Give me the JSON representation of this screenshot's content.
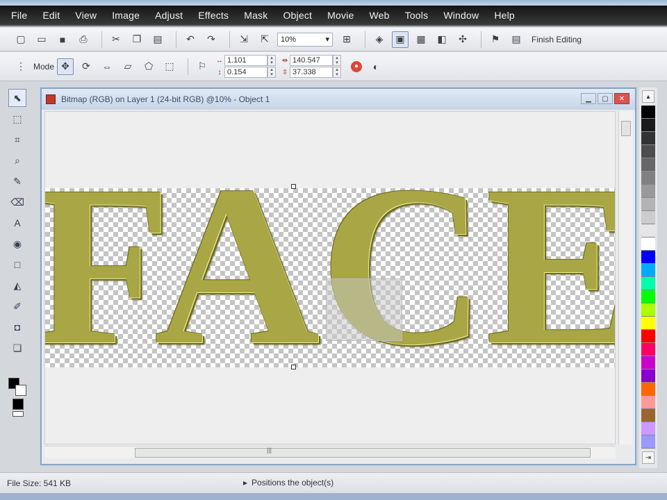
{
  "menu": [
    "File",
    "Edit",
    "View",
    "Image",
    "Adjust",
    "Effects",
    "Mask",
    "Object",
    "Movie",
    "Web",
    "Tools",
    "Window",
    "Help"
  ],
  "toolbar1": {
    "zoom_value": "10%",
    "finish_label": "Finish Editing"
  },
  "toolbar2": {
    "mode_label": "Mode",
    "x_value": "1.101",
    "y_value": "0.154",
    "width_value": "140.547",
    "height_value": "37.338"
  },
  "document": {
    "title": "Bitmap (RGB) on Layer 1 (24-bit RGB) @10% - Object 1",
    "canvas_text": "FACE"
  },
  "status": {
    "file_size": "File Size: 541 KB",
    "message": "Positions the object(s)"
  },
  "palette_colors": [
    "#000000",
    "#1a1a1a",
    "#333333",
    "#4d4d4d",
    "#666666",
    "#808080",
    "#999999",
    "#b3b3b3",
    "#cccccc",
    "#e6e6e6",
    "#ffffff",
    "#0000ff",
    "#00aaff",
    "#00ffaa",
    "#00ff00",
    "#aaff00",
    "#ffff00",
    "#ff0000",
    "#ff0066",
    "#cc00cc",
    "#8800cc",
    "#ff6600",
    "#ff9999",
    "#996633",
    "#cc99ff",
    "#9999ff"
  ]
}
